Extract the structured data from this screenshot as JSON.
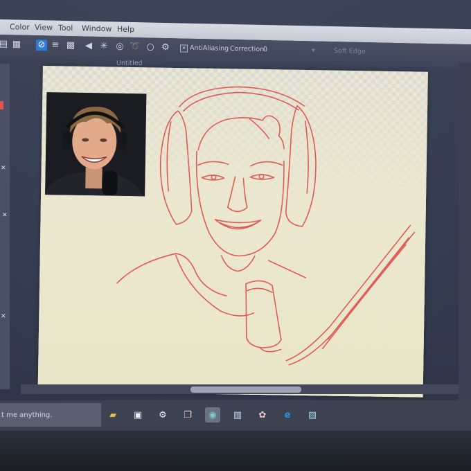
{
  "menu": {
    "items": [
      "Color",
      "View",
      "Tool",
      "Window",
      "Help"
    ]
  },
  "toolbar": {
    "antialiasing_label": "AntiAliasing",
    "correction_label": "Correction",
    "correction_value": "0",
    "soft_edge_label": "Soft Edge"
  },
  "document": {
    "tab_title": "Untitled"
  },
  "taskbar": {
    "search_placeholder": "t me anything."
  },
  "icons": {
    "toolbar": [
      "mirror-icon",
      "layers-icon",
      "grid-icon",
      "no-entry-icon",
      "stripes-icon",
      "checker-icon",
      "arrow-left-icon",
      "sparkle-icon",
      "circle-target-icon",
      "lasso-icon",
      "circle-icon",
      "gear-circle-icon"
    ],
    "taskbar": [
      "folder-icon",
      "store-icon",
      "settings-icon",
      "book-icon",
      "paint-app-icon",
      "notes-icon",
      "paint-brush-icon",
      "edge-browser-icon",
      "photos-icon"
    ]
  },
  "colors": {
    "sketch_stroke": "#e05a55",
    "selection_active": "#2f7ad6"
  }
}
